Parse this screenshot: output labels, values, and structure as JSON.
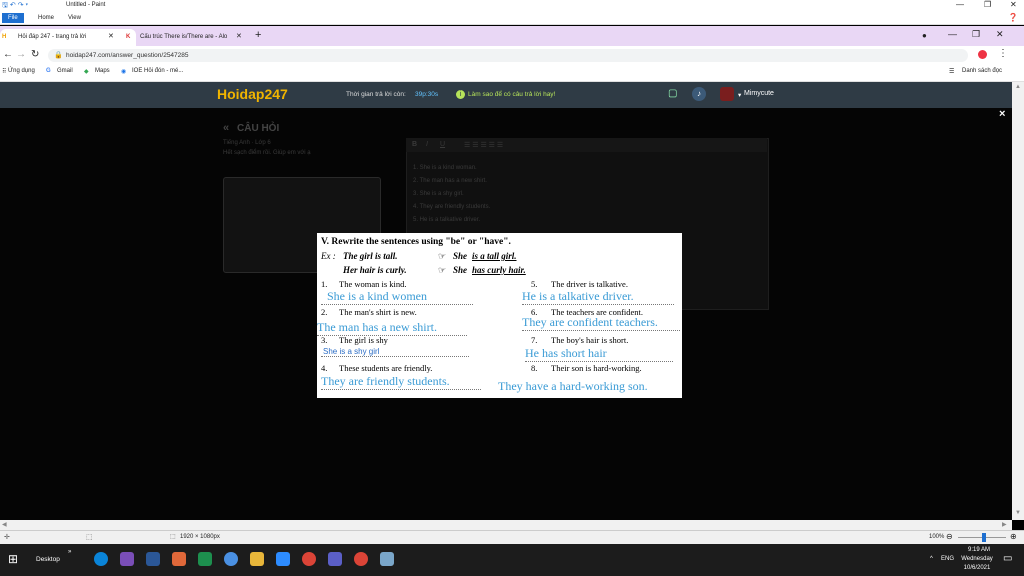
{
  "paint": {
    "title": "Untitled - Paint",
    "tabs": [
      "File",
      "Home",
      "View"
    ]
  },
  "browser": {
    "tabs": [
      {
        "label": "Hỏi đáp 247 - trang trả lời"
      },
      {
        "label": "Cấu trúc There is/There are - Alo"
      }
    ],
    "new_tab": "+",
    "url": "hoidap247.com/answer_question/2547285",
    "bookmarks": [
      "Ứng dụng",
      "Gmail",
      "Maps",
      "IOE Hỏi đón - mé..."
    ],
    "reading_list": "Danh sách đọc"
  },
  "site": {
    "logo": "Hoidap247",
    "timer_label": "Thời gian trả lời còn: ",
    "timer_value": "39p:30s",
    "help_link": "Làm sao để có câu trả lời hay!",
    "username": "Mimycute",
    "section_title": "CÂU HỎI",
    "subject": "Tiếng Anh · Lớp 6",
    "prompt_text": "Hết sạch điểm rồi. Giúp em với ạ",
    "editor_lines": [
      "1. She is a kind woman.",
      "2. The man has a new shirt.",
      "3. She is a shy girl.",
      "4. They are friendly students.",
      "5. He is a talkative driver."
    ],
    "close_icon": "×"
  },
  "worksheet": {
    "title": "V. Rewrite the sentences using \"be\" or \"have\".",
    "ex_label": "Ex :",
    "ex1_q": "The girl is tall.",
    "ex1_a_pre": "She ",
    "ex1_a_ul": "is a tall girl.",
    "ex2_q": "Her hair is curly.",
    "ex2_a_pre": "She ",
    "ex2_a_ul": "has curly hair.",
    "arrow": "☞",
    "items": [
      {
        "n": "1.",
        "q": "The woman is kind.",
        "a": "She is a kind women"
      },
      {
        "n": "2.",
        "q": "The man's shirt is new.",
        "a": "The man has a new shirt."
      },
      {
        "n": "3.",
        "q": "The girl is shy",
        "a": "She is a shy girl"
      },
      {
        "n": "4.",
        "q": "These students are friendly.",
        "a": "They are friendly students."
      },
      {
        "n": "5.",
        "q": "The driver is talkative.",
        "a": "He is a talkative driver."
      },
      {
        "n": "6.",
        "q": "The teachers are confident.",
        "a": "They are confident teachers."
      },
      {
        "n": "7.",
        "q": "The boy's hair is short.",
        "a": "He has short hair"
      },
      {
        "n": "8.",
        "q": "Their son is hard-working.",
        "a": "They have a hard-working son."
      }
    ]
  },
  "status": {
    "dimensions": "1920 × 1080px",
    "zoom": "100%"
  },
  "taskbar": {
    "desktop": "Desktop",
    "lang": "ENG",
    "time": "9:19 AM",
    "day": "Wednesday",
    "date": "10/6/2021"
  },
  "colors": {
    "accent_blue": "#3a9bd5",
    "header": "#2f3b45",
    "timer": "#62c3ff",
    "help": "#b6e35a"
  }
}
